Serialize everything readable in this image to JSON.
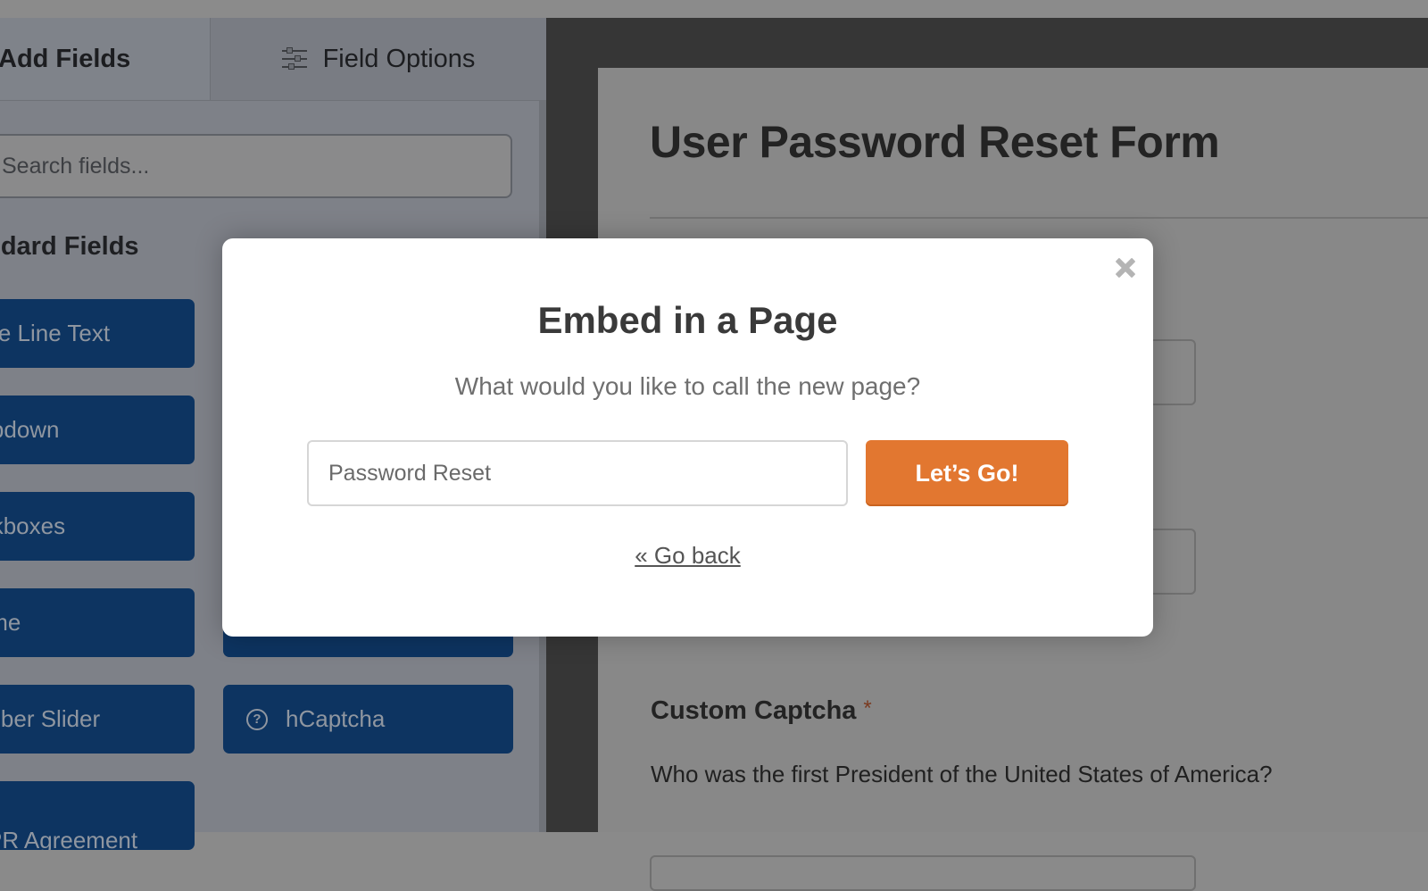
{
  "builder": {
    "tabs": [
      {
        "label": "Add Fields",
        "icon": "list-icon",
        "active": true
      },
      {
        "label": "Field Options",
        "icon": "sliders-icon",
        "active": false
      }
    ],
    "search": {
      "placeholder": "Search fields...",
      "visible_text": "arch fields..."
    },
    "section_title": "Standard Fields",
    "fields_col1": [
      "Single Line Text",
      "Dropdown",
      "Checkboxes",
      "Name",
      "Number Slider",
      "GDPR Agreement"
    ],
    "fields_col2": [
      {
        "label": "",
        "icon": ""
      },
      {
        "label": "hCaptcha",
        "icon": "question-circle-icon"
      }
    ]
  },
  "preview": {
    "form_title": "User Password Reset Form",
    "captcha_label": "Custom Captcha",
    "required_marker": "*",
    "captcha_question": "Who was the first President of the United States of America?"
  },
  "modal": {
    "title": "Embed in a Page",
    "subtitle": "What would you like to call the new page?",
    "input_value": "Password Reset",
    "submit_label": "Let’s Go!",
    "back_link": "« Go back",
    "close_icon": "close-icon",
    "accent_color": "#e27730"
  },
  "colors": {
    "field_button_bg": "#0d3461",
    "overlay_dim": "#888888"
  }
}
